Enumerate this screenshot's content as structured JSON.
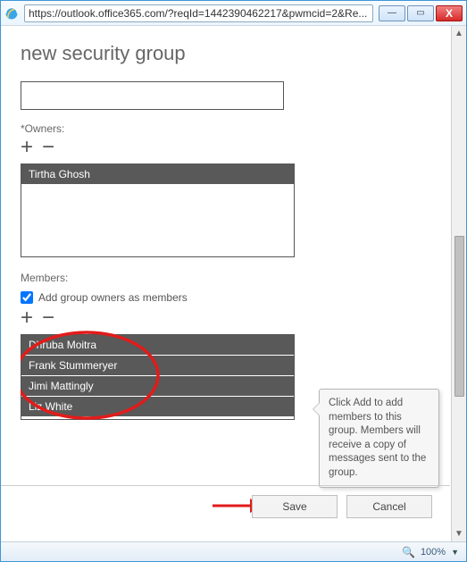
{
  "window": {
    "url": "https://outlook.office365.com/?reqId=1442390462217&pwmcid=2&Re...",
    "btn_min": "—",
    "btn_max": "▭",
    "btn_close": "X",
    "zoom": "100%"
  },
  "page": {
    "title": "new security group"
  },
  "owners": {
    "label": "*Owners:",
    "items": [
      "Tirtha Ghosh"
    ]
  },
  "members": {
    "label": "Members:",
    "checkbox_label": "Add group owners as members",
    "checkbox_checked": true,
    "items": [
      "Dhruba Moitra",
      "Frank Stummeryer",
      "Jimi Mattingly",
      "Liz White"
    ]
  },
  "tooltip": {
    "text": "Click Add to add members to this group. Members will receive a copy of messages sent to the group."
  },
  "buttons": {
    "save": "Save",
    "cancel": "Cancel"
  }
}
